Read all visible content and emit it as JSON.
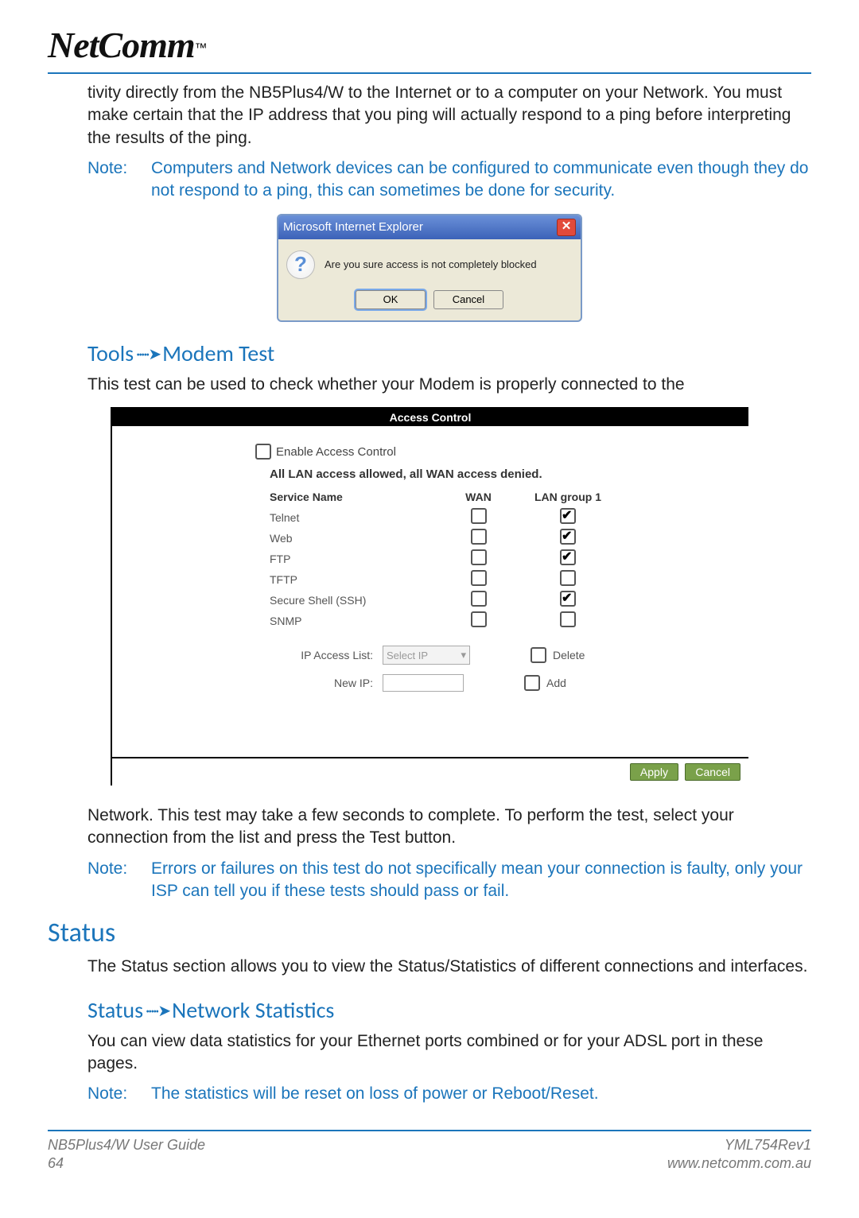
{
  "logo": {
    "text": "NetComm",
    "tm": "™"
  },
  "intro_para": "tivity directly from the NB5Plus4/W to the Internet or to a computer on your Network. You must make certain that the IP address that you ping will actually respond to a ping before interpreting the results of the ping.",
  "note1": {
    "label": "Note:",
    "text": "Computers and Network devices can be configured to communicate even though they do not respond to a ping, this can sometimes be done for security."
  },
  "dialog": {
    "title": "Microsoft Internet Explorer",
    "message": "Are you sure access is not completely blocked",
    "ok": "OK",
    "cancel": "Cancel"
  },
  "h_modem": {
    "left": "Tools",
    "right": "Modem Test"
  },
  "modem_para1": "This test can be used to check whether your Modem is properly connected to the",
  "panel": {
    "title": "Access Control",
    "enable": "Enable Access Control",
    "allowdeny": "All LAN access allowed, all WAN access denied.",
    "col1": "Service Name",
    "col2": "WAN",
    "col3": "LAN group 1",
    "services": [
      {
        "name": "Telnet",
        "wan": false,
        "lan": true
      },
      {
        "name": "Web",
        "wan": false,
        "lan": true
      },
      {
        "name": "FTP",
        "wan": false,
        "lan": true
      },
      {
        "name": "TFTP",
        "wan": false,
        "lan": false
      },
      {
        "name": "Secure Shell (SSH)",
        "wan": false,
        "lan": true
      },
      {
        "name": "SNMP",
        "wan": false,
        "lan": false
      }
    ],
    "ip_access_label": "IP Access List:",
    "ip_access_select": "Select IP",
    "delete": "Delete",
    "new_ip_label": "New IP:",
    "add": "Add",
    "apply": "Apply",
    "cancel": "Cancel"
  },
  "modem_para2": "Network. This test may take a few seconds to complete. To perform the test, select your connection from the list and press the Test button.",
  "note2": {
    "label": "Note:",
    "text": "Errors or failures on this test do not specifically mean your connection is faulty, only your ISP can tell you if these tests should pass or fail."
  },
  "h_status": "Status",
  "status_para": "The Status section allows you to view the Status/Statistics of different connections and interfaces.",
  "h_netstat": {
    "left": "Status",
    "right": "Network Statistics"
  },
  "netstat_para": "You can view data statistics for your Ethernet ports combined or for your ADSL port in these pages.",
  "note3": {
    "label": "Note:",
    "text": "The statistics will be reset on loss of power or Reboot/Reset."
  },
  "footer": {
    "guide": "NB5Plus4/W User Guide",
    "page": "64",
    "rev": "YML754Rev1",
    "url": "www.netcomm.com.au"
  }
}
